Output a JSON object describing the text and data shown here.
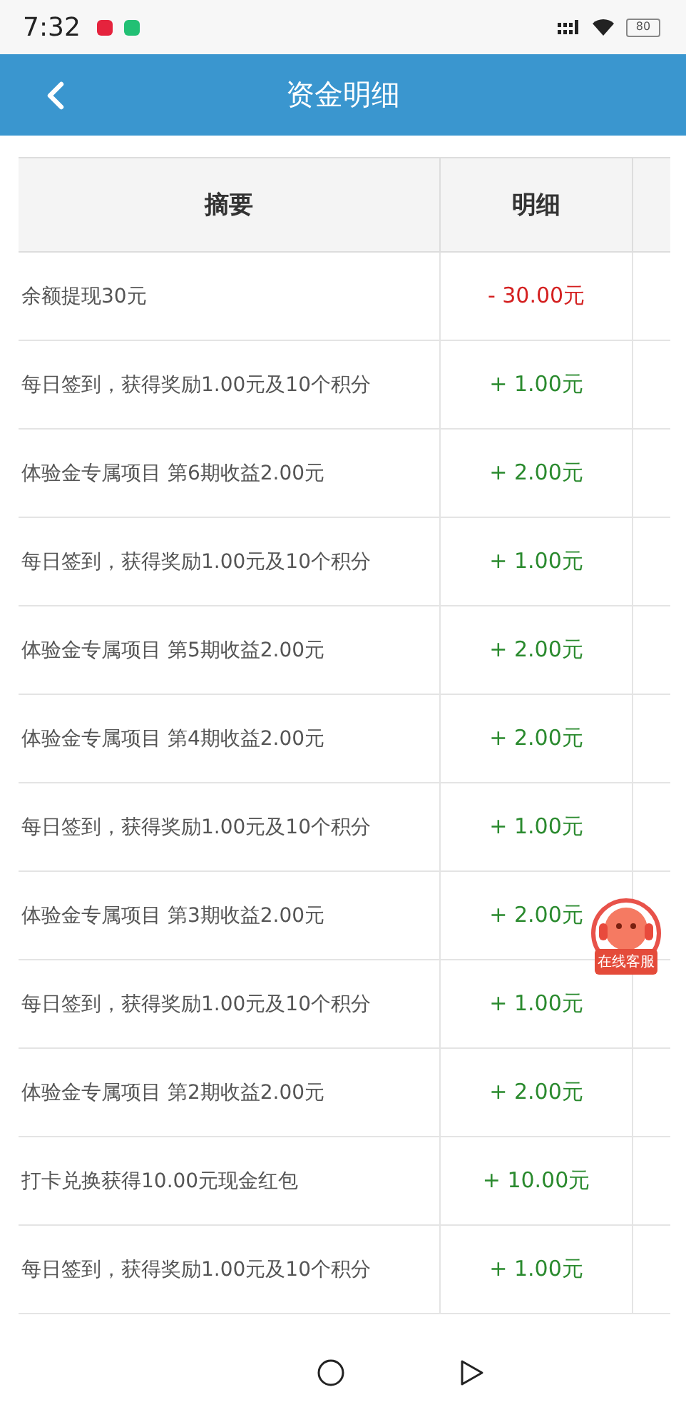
{
  "status_bar": {
    "time": "7:32",
    "battery": "80"
  },
  "header": {
    "title": "资金明细"
  },
  "table": {
    "columns": [
      "摘要",
      "明细"
    ],
    "rows": [
      {
        "summary": "余额提现30元",
        "amount": "- 30.00元",
        "kind": "debit"
      },
      {
        "summary": "每日签到，获得奖励1.00元及10个积分",
        "amount": "+ 1.00元",
        "kind": "credit"
      },
      {
        "summary": "体验金专属项目 第6期收益2.00元",
        "amount": "+ 2.00元",
        "kind": "credit"
      },
      {
        "summary": "每日签到，获得奖励1.00元及10个积分",
        "amount": "+ 1.00元",
        "kind": "credit"
      },
      {
        "summary": "体验金专属项目 第5期收益2.00元",
        "amount": "+ 2.00元",
        "kind": "credit"
      },
      {
        "summary": "体验金专属项目 第4期收益2.00元",
        "amount": "+ 2.00元",
        "kind": "credit"
      },
      {
        "summary": "每日签到，获得奖励1.00元及10个积分",
        "amount": "+ 1.00元",
        "kind": "credit"
      },
      {
        "summary": "体验金专属项目 第3期收益2.00元",
        "amount": "+ 2.00元",
        "kind": "credit"
      },
      {
        "summary": "每日签到，获得奖励1.00元及10个积分",
        "amount": "+ 1.00元",
        "kind": "credit"
      },
      {
        "summary": "体验金专属项目 第2期收益2.00元",
        "amount": "+ 2.00元",
        "kind": "credit"
      },
      {
        "summary": "打卡兑换获得10.00元现金红包",
        "amount": "+ 10.00元",
        "kind": "credit"
      },
      {
        "summary": "每日签到，获得奖励1.00元及10个积分",
        "amount": "+ 1.00元",
        "kind": "credit"
      }
    ]
  },
  "float_button": {
    "label": "在线客服"
  }
}
